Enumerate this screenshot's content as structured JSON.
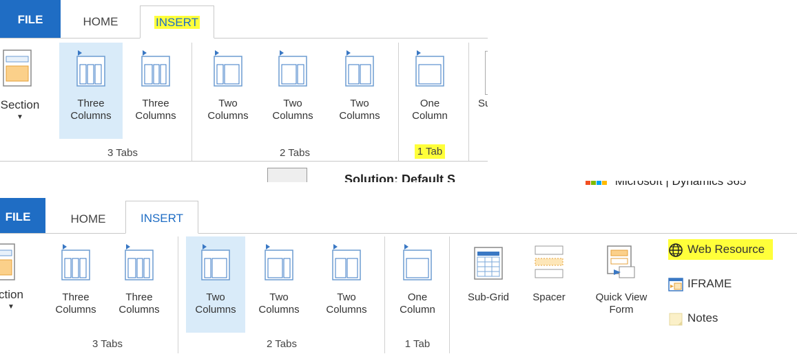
{
  "top_ribbon": {
    "tabs": {
      "file": "FILE",
      "home": "HOME",
      "insert": "INSERT"
    },
    "section_label": "Section",
    "three_col_a": [
      "Three",
      "Columns"
    ],
    "three_col_b": [
      "Three",
      "Columns"
    ],
    "two_col_a": [
      "Two",
      "Columns"
    ],
    "two_col_b": [
      "Two",
      "Columns"
    ],
    "two_col_c": [
      "Two",
      "Columns"
    ],
    "one_col": [
      "One",
      "Column"
    ],
    "cut_label": "Su",
    "groups": {
      "three_tabs": "3 Tabs",
      "two_tabs": "2 Tabs",
      "one_tab": "1 Tab"
    },
    "cut_breadcrumb": "Solution: Default S"
  },
  "brand": {
    "text": "Microsoft | Dynamics 365"
  },
  "bottom_ribbon": {
    "tabs": {
      "file": "FILE",
      "home": "HOME",
      "insert": "INSERT"
    },
    "section_label": "ction",
    "three_col_a": [
      "Three",
      "Columns"
    ],
    "three_col_b": [
      "Three",
      "Columns"
    ],
    "two_col_a": [
      "Two",
      "Columns"
    ],
    "two_col_b": [
      "Two",
      "Columns"
    ],
    "two_col_c": [
      "Two",
      "Columns"
    ],
    "one_col": [
      "One",
      "Column"
    ],
    "sub_grid": "Sub-Grid",
    "spacer": "Spacer",
    "quick_view": [
      "Quick View",
      "Form"
    ],
    "web_resource": "Web Resource",
    "iframe": "IFRAME",
    "notes": "Notes",
    "groups": {
      "three_tabs": "3 Tabs",
      "two_tabs": "2 Tabs",
      "one_tab": "1 Tab"
    }
  },
  "colors": {
    "file_tab": "#1f6dc4",
    "highlight": "#ffff3a",
    "selected": "#d9ebf9",
    "accent": "#1f6dc4"
  }
}
